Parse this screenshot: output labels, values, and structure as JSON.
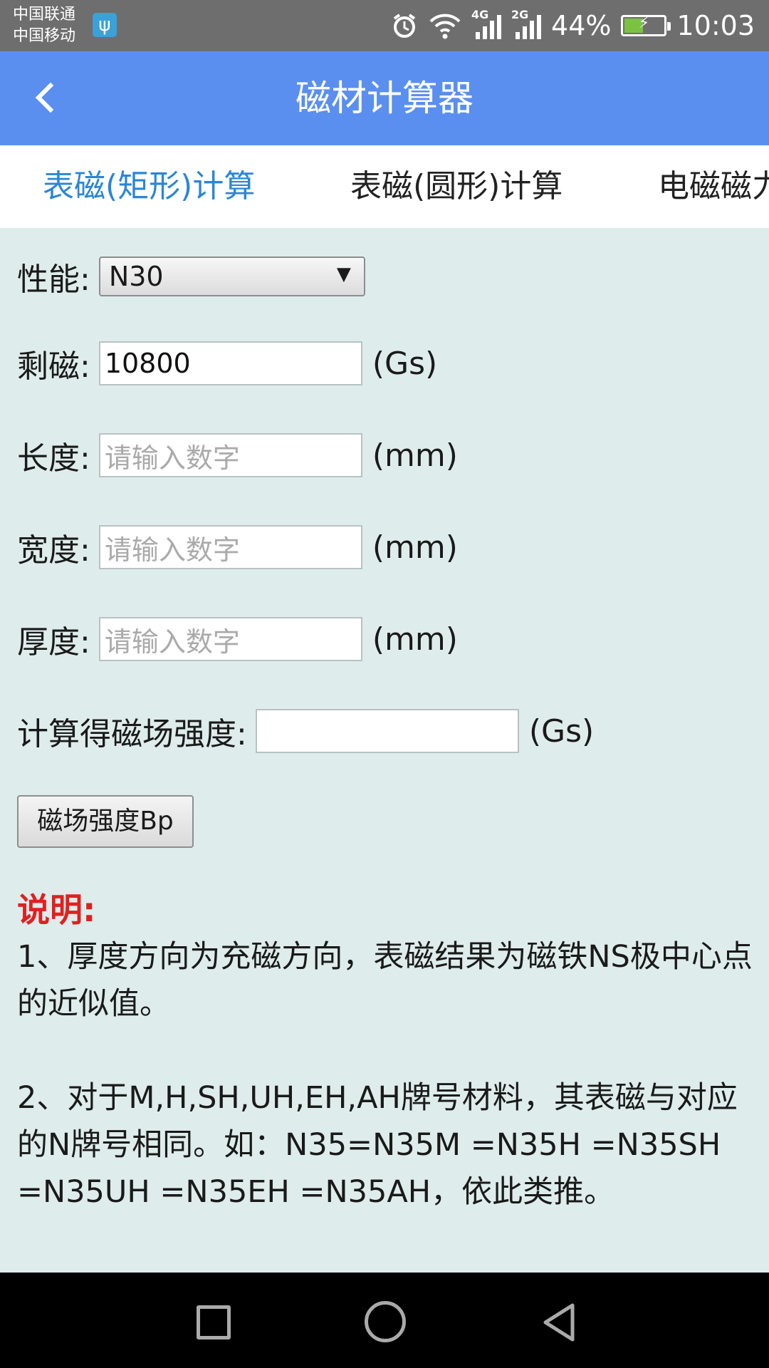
{
  "status_bar": {
    "carrier1": "中国联通",
    "carrier2": "中国移动",
    "net1": "4G",
    "net2": "2G",
    "battery": "44%",
    "time": "10:03"
  },
  "header": {
    "title": "磁材计算器"
  },
  "tabs": [
    {
      "label": "表磁(矩形)计算"
    },
    {
      "label": "表磁(圆形)计算"
    },
    {
      "label": "电磁磁力"
    }
  ],
  "form": {
    "grade_label": "性能:",
    "grade_value": "N30",
    "remanence_label": "剩磁:",
    "remanence_value": "10800",
    "remanence_unit": "(Gs)",
    "length_label": "长度:",
    "length_placeholder": "请输入数字",
    "length_unit": "(mm)",
    "width_label": "宽度:",
    "width_placeholder": "请输入数字",
    "width_unit": "(mm)",
    "thickness_label": "厚度:",
    "thickness_placeholder": "请输入数字",
    "thickness_unit": "(mm)",
    "result_label": "计算得磁场强度:",
    "result_value": "",
    "result_unit": "(Gs)",
    "calc_button": "磁场强度Bp"
  },
  "notes": {
    "title": "说明:",
    "item1": "1、厚度方向为充磁方向，表磁结果为磁铁NS极中心点的近似值。",
    "item2": "2、对于M,H,SH,UH,EH,AH牌号材料，其表磁与对应的N牌号相同。如：N35=N35M =N35H =N35SH =N35UH =N35EH =N35AH，依此类推。"
  },
  "colors": {
    "header": "#5a8ff0",
    "active_tab": "#2a86d6",
    "note_title": "#e02020",
    "background": "#dfecec"
  }
}
